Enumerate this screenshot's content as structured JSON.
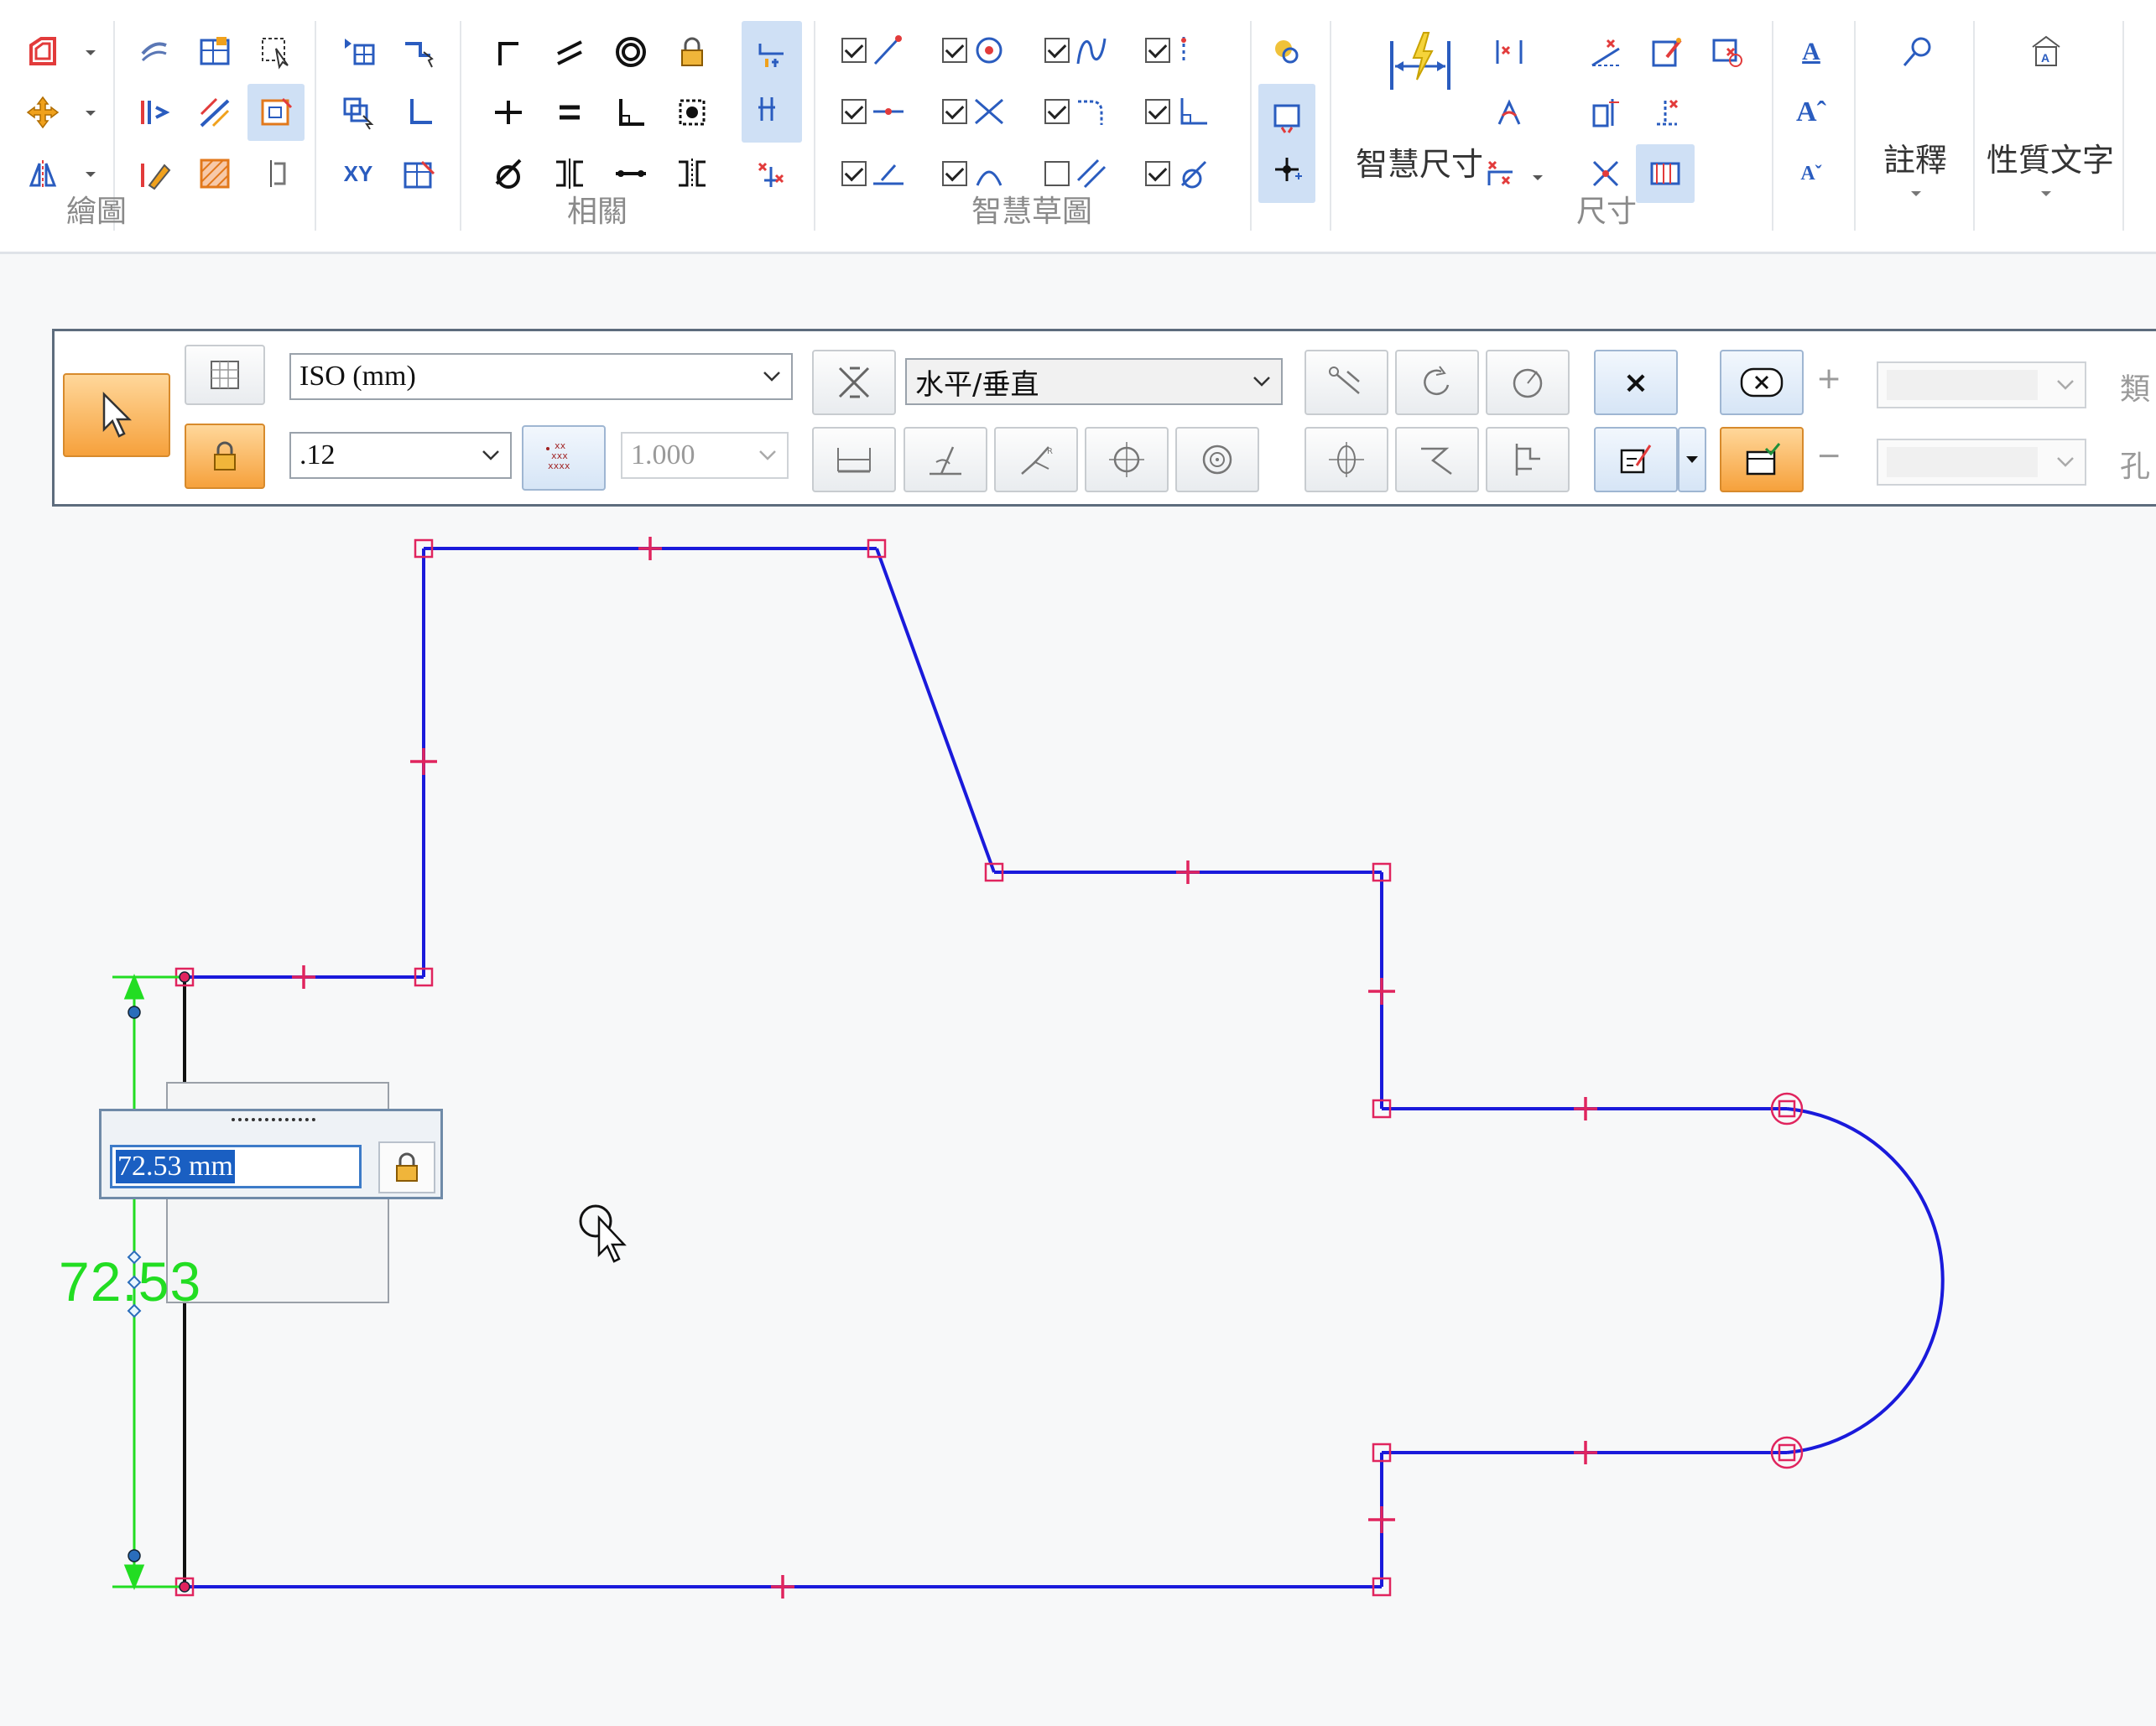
{
  "ribbon": {
    "groups": {
      "draw": "繪圖",
      "relate": "相關",
      "intellisketch": "智慧草圖",
      "dimension": "尺寸"
    },
    "smart_dimension": "智慧尺寸",
    "annotation": "註釋",
    "property_text": "性質文字",
    "xy_label": "XY"
  },
  "command_bar": {
    "style_value": "ISO (mm)",
    "precision_value": ".12",
    "scale_value": "1.000",
    "orientation_value": "水平/垂直",
    "close_label": "×",
    "plus_label": "+",
    "minus_label": "−",
    "right_label_1": "類",
    "right_label_2": "孔"
  },
  "dimension_edit": {
    "value": "72.53 mm"
  },
  "dimension_display": {
    "text": "72.53"
  },
  "colors": {
    "geometry": "#1a1adb",
    "keypoint": "#e0245e",
    "dimension": "#22dd22",
    "accent_orange": "#f6a13c"
  }
}
